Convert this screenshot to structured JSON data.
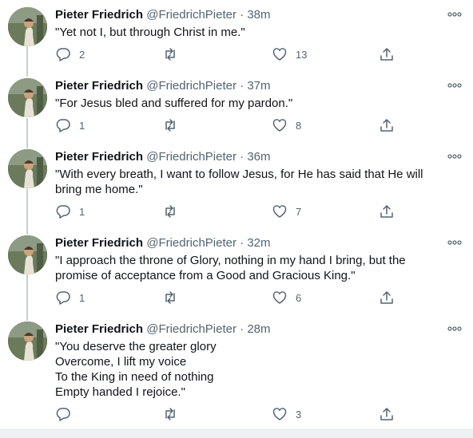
{
  "tweets": [
    {
      "name": "Pieter Friedrich",
      "handle": "@FriedrichPieter",
      "separator": "·",
      "time": "38m",
      "lines": [
        "\"Yet not I, but through Christ in me.\""
      ],
      "replies": "2",
      "retweets": "",
      "likes": "13"
    },
    {
      "name": "Pieter Friedrich",
      "handle": "@FriedrichPieter",
      "separator": "·",
      "time": "37m",
      "lines": [
        "\"For Jesus bled and suffered for my pardon.\""
      ],
      "replies": "1",
      "retweets": "",
      "likes": "8"
    },
    {
      "name": "Pieter Friedrich",
      "handle": "@FriedrichPieter",
      "separator": "·",
      "time": "36m",
      "lines": [
        "\"With every breath, I want to follow Jesus, for He has said that He will",
        "bring me home.\""
      ],
      "replies": "1",
      "retweets": "",
      "likes": "7"
    },
    {
      "name": "Pieter Friedrich",
      "handle": "@FriedrichPieter",
      "separator": "·",
      "time": "32m",
      "lines": [
        "\"I approach the throne of Glory, nothing in my hand I bring, but the",
        "promise of acceptance from a Good and Gracious King.\""
      ],
      "replies": "1",
      "retweets": "",
      "likes": "6"
    },
    {
      "name": "Pieter Friedrich",
      "handle": "@FriedrichPieter",
      "separator": "·",
      "time": "28m",
      "lines": [
        "\"You deserve the greater glory",
        "Overcome, I lift my voice",
        "To the King in need of nothing",
        "Empty handed I rejoice.\""
      ],
      "replies": "",
      "retweets": "",
      "likes": "3"
    }
  ],
  "icons": {
    "more": "more-dots-icon",
    "reply": "reply-icon",
    "retweet": "retweet-icon",
    "like": "heart-icon",
    "share": "share-icon"
  },
  "colors": {
    "text": "#0f1419",
    "muted": "#536471",
    "thread_line": "#c4cfd6"
  }
}
